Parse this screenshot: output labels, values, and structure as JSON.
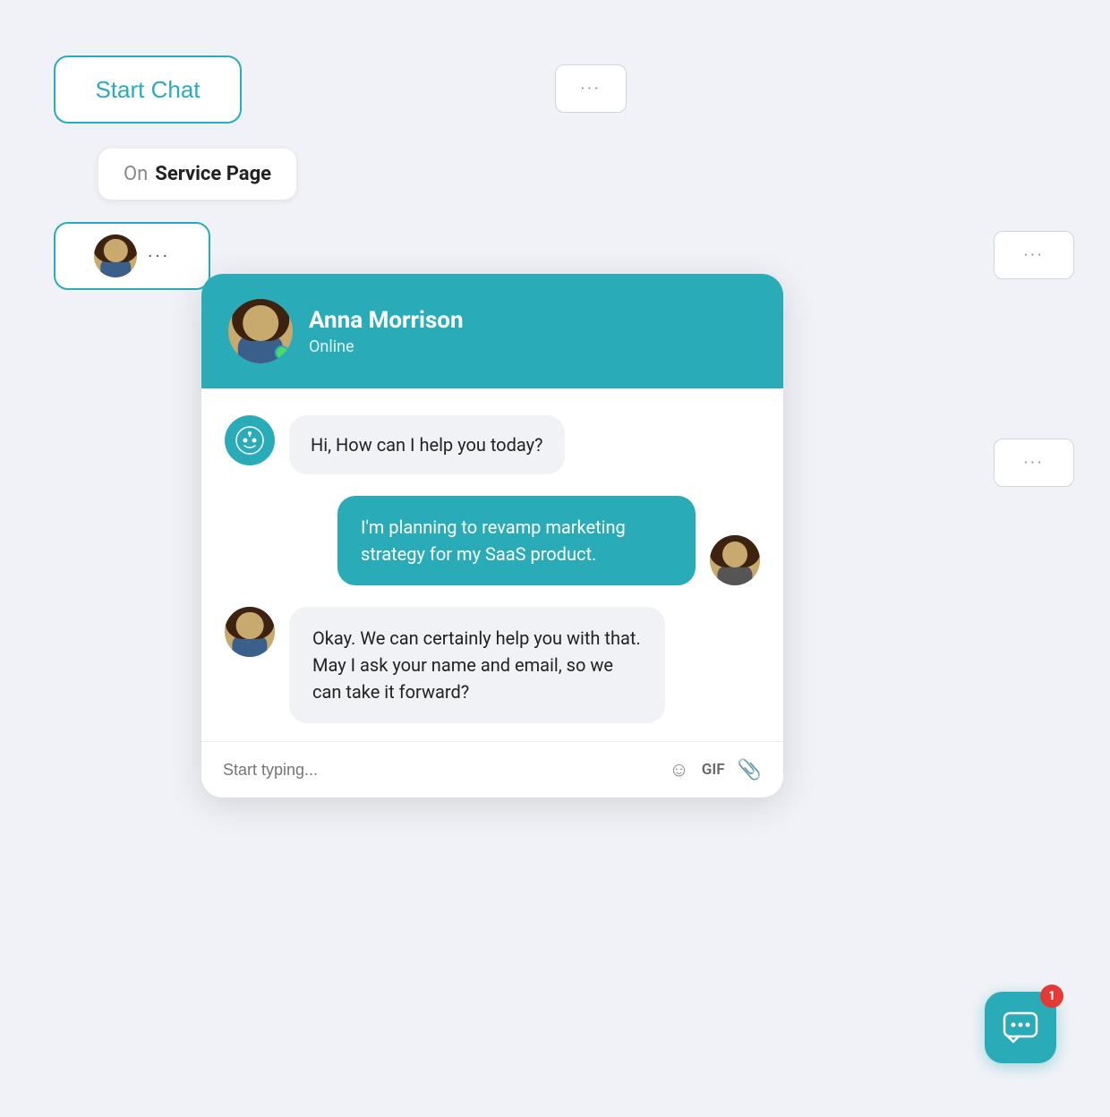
{
  "startChat": {
    "label": "Start Chat"
  },
  "topRightDots": {
    "label": "···"
  },
  "servicePageTag": {
    "on": "On",
    "page": "Service Page"
  },
  "avatarDotsBtn": {
    "dots": "···"
  },
  "rightDots1": {
    "label": "···"
  },
  "rightDots2": {
    "label": "···"
  },
  "chatHeader": {
    "agentName": "Anna Morrison",
    "agentStatus": "Online"
  },
  "chatMessages": [
    {
      "type": "bot",
      "text": "Hi, How can I help you today?"
    },
    {
      "type": "user",
      "text": "I'm planning to revamp marketing strategy for my SaaS product."
    },
    {
      "type": "agent",
      "text": "Okay. We can certainly help you with that. May I ask your name and email, so we can take it forward?"
    }
  ],
  "chatInput": {
    "placeholder": "Start typing..."
  },
  "widgetBadge": {
    "count": "1"
  }
}
